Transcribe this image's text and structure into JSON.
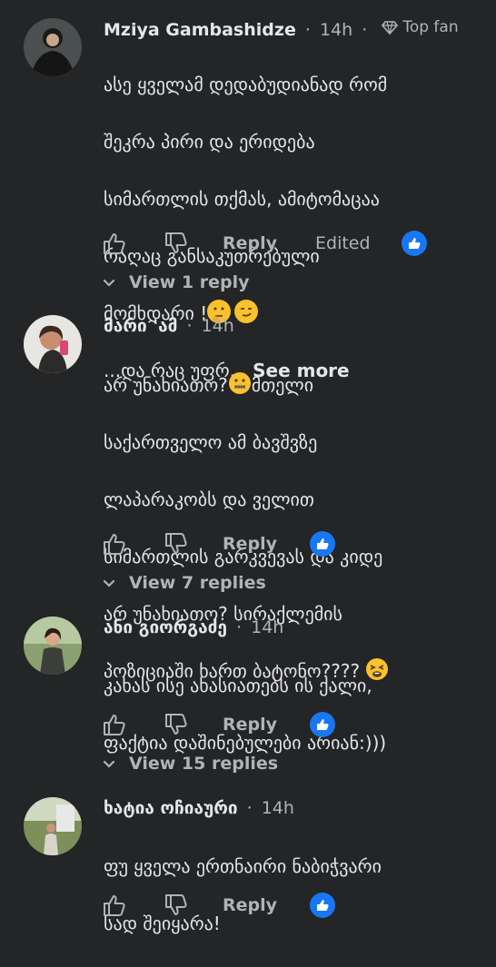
{
  "comments": [
    {
      "author": "Mziya Gambashidze",
      "time": "14h",
      "badge": "Top fan",
      "lines": [
        "ასე ყველამ დედაბუდიანად რომ",
        "შეკრა პირი და ერიდება",
        "სიმართლის თქმას, ამიტომაცაა",
        "რაღაც განსაკუთრებული",
        "მომხდარი !"
      ],
      "more_prefix": "...და რაც უფრ...",
      "see_more": "See more",
      "reply": "Reply",
      "edited": "Edited",
      "view_replies": "View 1 reply"
    },
    {
      "author": "მარი 'ამ",
      "time": "14h",
      "lines": [
        "არ უნახიათო?",
        "საქართველო ამ ბავშვზე",
        "ლაპარაკობს და ველით",
        "სიმართლის გარკვევას და კიდე",
        "არ უნახიათო? სირაქლემის",
        "პოზიციაში ხართ ბატონო????"
      ],
      "line1_rest": "მთელი",
      "reply": "Reply",
      "view_replies": "View 7 replies"
    },
    {
      "author": "ანი გიორგაძე",
      "time": "14h",
      "lines": [
        "კახას ისე ახასიათებს ის ქალი,",
        "ფაქტია დაშინებულები არიან:)))"
      ],
      "reply": "Reply",
      "view_replies": "View 15 replies"
    },
    {
      "author": "ხატია ოჩიაური",
      "time": "14h",
      "lines": [
        "ფუ ყველა ერთნაირი ნაბიჭვარი",
        "სად შეიყარა!"
      ],
      "reply": "Reply"
    }
  ],
  "colors": {
    "background": "#242526",
    "text": "#e4e6eb",
    "muted": "#b0b3b8",
    "like": "#1877f2"
  },
  "icons": [
    "thumbs-up-icon",
    "thumbs-down-icon",
    "like-reaction-icon",
    "chevron-down-icon",
    "diamond-icon"
  ]
}
